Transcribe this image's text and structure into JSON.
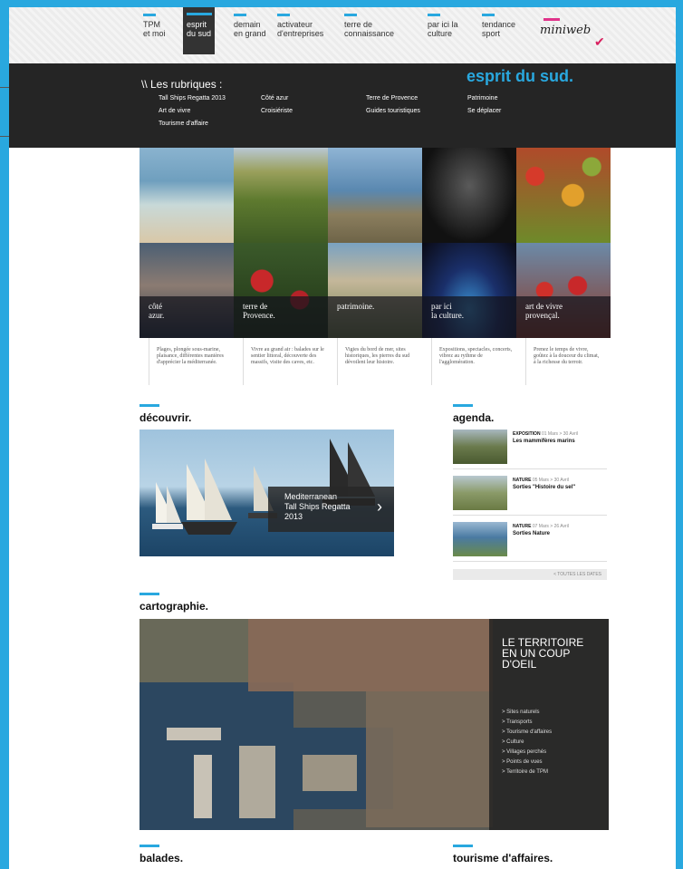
{
  "nav": {
    "items": [
      {
        "line1": "TPM",
        "line2": "et moi"
      },
      {
        "line1": "esprit",
        "line2": "du sud"
      },
      {
        "line1": "demain",
        "line2": "en grand"
      },
      {
        "line1": "activateur",
        "line2": "d'entreprises"
      },
      {
        "line1": "terre de",
        "line2": "connaissance"
      },
      {
        "line1": "par ici la",
        "line2": "culture"
      },
      {
        "line1": "tendance",
        "line2": "sport"
      }
    ],
    "logo": "miniweb"
  },
  "dropdown": {
    "heading": "\\\\ Les rubriques :",
    "section_title": "esprit du sud.",
    "links": [
      "Tall Ships Regatta 2013",
      "Art de vivre",
      "Tourisme d'affaire",
      "Côté azur",
      "Croisiériste",
      "Terre de Provence",
      "Guides touristiques",
      "Patrimoine",
      "Se déplacer"
    ]
  },
  "mosaic": {
    "tiles": [
      {
        "caption1": "côté",
        "caption2": "azur.",
        "desc": "Plages, plongée sous-marine, plaisance, différentes manières d'apprécier la méditerranée."
      },
      {
        "caption1": "terre de",
        "caption2": "Provence.",
        "desc": "Vivre au grand air : balades sur le sentier littoral, découverte des massifs, visite des caves, etc."
      },
      {
        "caption1": "patrimoine.",
        "caption2": "",
        "desc": "Vigies du bord de mer, sites historiques, les pierres du sud dévoilent leur histoire."
      },
      {
        "caption1": "par ici",
        "caption2": "la culture.",
        "desc": "Expositions, spectacles, concerts, vibrez au rythme de l'agglomération."
      },
      {
        "caption1": "art de vivre",
        "caption2": "provençal.",
        "desc": "Prenez le temps de vivre, goûtez à la douceur du climat, à la richesse du terroir."
      }
    ]
  },
  "sections": {
    "discover": "découvrir.",
    "agenda": "agenda.",
    "map": "cartographie.",
    "walks": "balades.",
    "business": "tourisme d'affaires."
  },
  "discover": {
    "callout1": "Mediterranean",
    "callout2": "Tall Ships Regatta",
    "callout3": "2013",
    "arrow": "›"
  },
  "agenda": {
    "items": [
      {
        "category": "EXPOSITION",
        "dates": "01 Mars > 30 Avril",
        "title": "Les mammifères marins"
      },
      {
        "category": "NATURE",
        "dates": "05 Mars > 30 Avril",
        "title": "Sorties \"Histoire du sel\""
      },
      {
        "category": "NATURE",
        "dates": "07 Mars > 26 Avril",
        "title": "Sorties Nature"
      }
    ],
    "all_dates": "< TOUTES LES DATES"
  },
  "map": {
    "title1": "LE TERRITOIRE",
    "title2": "EN UN COUP",
    "title3": "D'OEIL",
    "links": [
      "> Sites naturels",
      "> Transports",
      "> Tourisme d'affaires",
      "> Culture",
      "> Villages perchés",
      "> Points de vues",
      "> Territoire de TPM"
    ]
  },
  "colors": {
    "accent": "#29a8df",
    "dark": "#252525",
    "logo_pink": "#e0338a"
  }
}
